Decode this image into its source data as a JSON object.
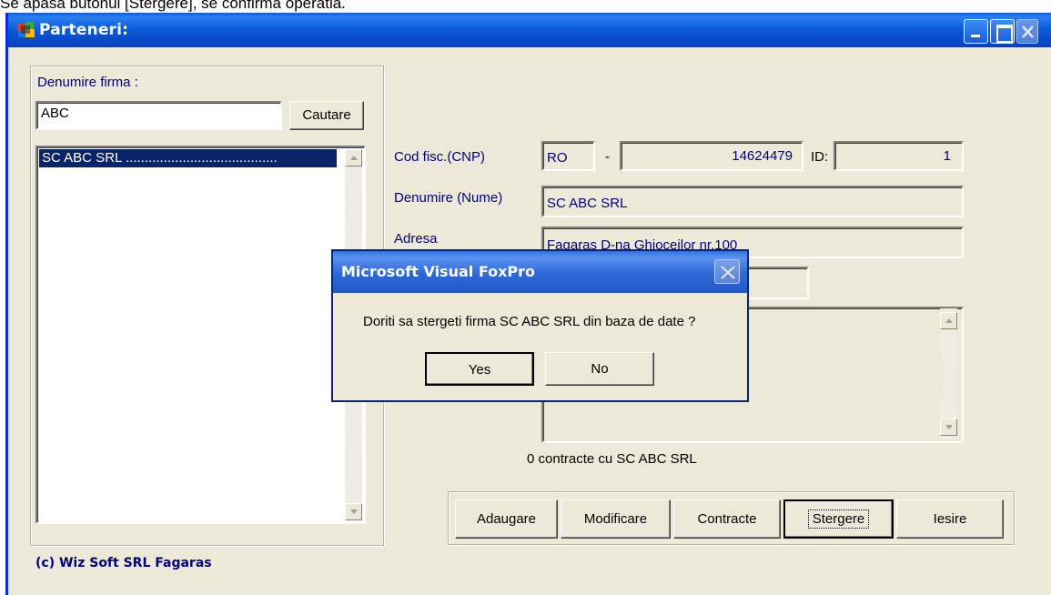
{
  "caption": "Se apasa butonul [Stergere], se confirma operatia.",
  "window": {
    "title": "Parteneri:",
    "buttons": {
      "minimize": "minimize",
      "maximize": "maximize",
      "close": "close"
    }
  },
  "search": {
    "label": "Denumire firma :",
    "value": "ABC",
    "button_label": "Cautare"
  },
  "list": {
    "items": [
      "SC ABC SRL ........................................"
    ],
    "selected_index": 0
  },
  "form": {
    "cod_fisc_label": "Cod fisc.(CNP)",
    "cod_prefix": "RO",
    "dash": "-",
    "cod_number": "14624479",
    "id_label": "ID:",
    "id_value": "1",
    "denumire_label": "Denumire (Nume)",
    "denumire_value": "SC ABC SRL",
    "adresa_label": "Adresa",
    "adresa_value": "Fagaras D-na Ghioceilor nr.100",
    "contracts_status": "0 contracte cu SC ABC SRL"
  },
  "toolbar": {
    "adaugare": "Adaugare",
    "modificare": "Modificare",
    "contracte": "Contracte",
    "stergere": "Stergere",
    "iesire": "Iesire"
  },
  "footer": {
    "copyright": "(c) Wiz Soft SRL Fagaras"
  },
  "dialog": {
    "title": "Microsoft Visual FoxPro",
    "message": "Doriti sa stergeti firma SC ABC SRL din baza de date ?",
    "yes_label": "Yes",
    "no_label": "No"
  },
  "colors": {
    "titlebar": "#0a58d6",
    "window_bg": "#ece9d8",
    "label_text": "#000080",
    "selection": "#0a246a"
  }
}
